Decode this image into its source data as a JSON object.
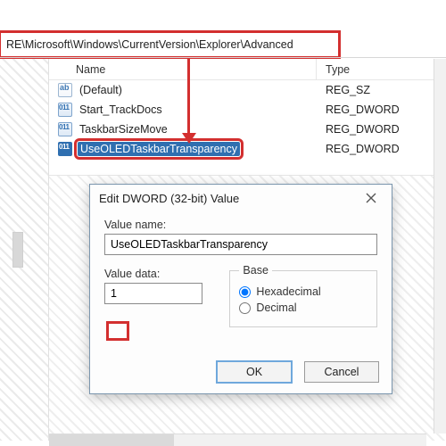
{
  "path": "RE\\Microsoft\\Windows\\CurrentVersion\\Explorer\\Advanced",
  "columns": {
    "name": "Name",
    "type": "Type"
  },
  "rows": [
    {
      "name": "(Default)",
      "type": "REG_SZ",
      "icon": "sz",
      "selected": false,
      "highlight": false
    },
    {
      "name": "Start_TrackDocs",
      "type": "REG_DWORD",
      "icon": "dword",
      "selected": false,
      "highlight": false
    },
    {
      "name": "TaskbarSizeMove",
      "type": "REG_DWORD",
      "icon": "dword",
      "selected": false,
      "highlight": false
    },
    {
      "name": "UseOLEDTaskbarTransparency",
      "type": "REG_DWORD",
      "icon": "dword",
      "selected": true,
      "highlight": true
    }
  ],
  "dialog": {
    "title": "Edit DWORD (32-bit) Value",
    "valueNameLabel": "Value name:",
    "valueName": "UseOLEDTaskbarTransparency",
    "valueDataLabel": "Value data:",
    "valueData": "1",
    "baseLegend": "Base",
    "hexLabel": "Hexadecimal",
    "decLabel": "Decimal",
    "baseSelected": "hex",
    "ok": "OK",
    "cancel": "Cancel"
  },
  "annotations": {
    "accent": "#d32f2f"
  }
}
